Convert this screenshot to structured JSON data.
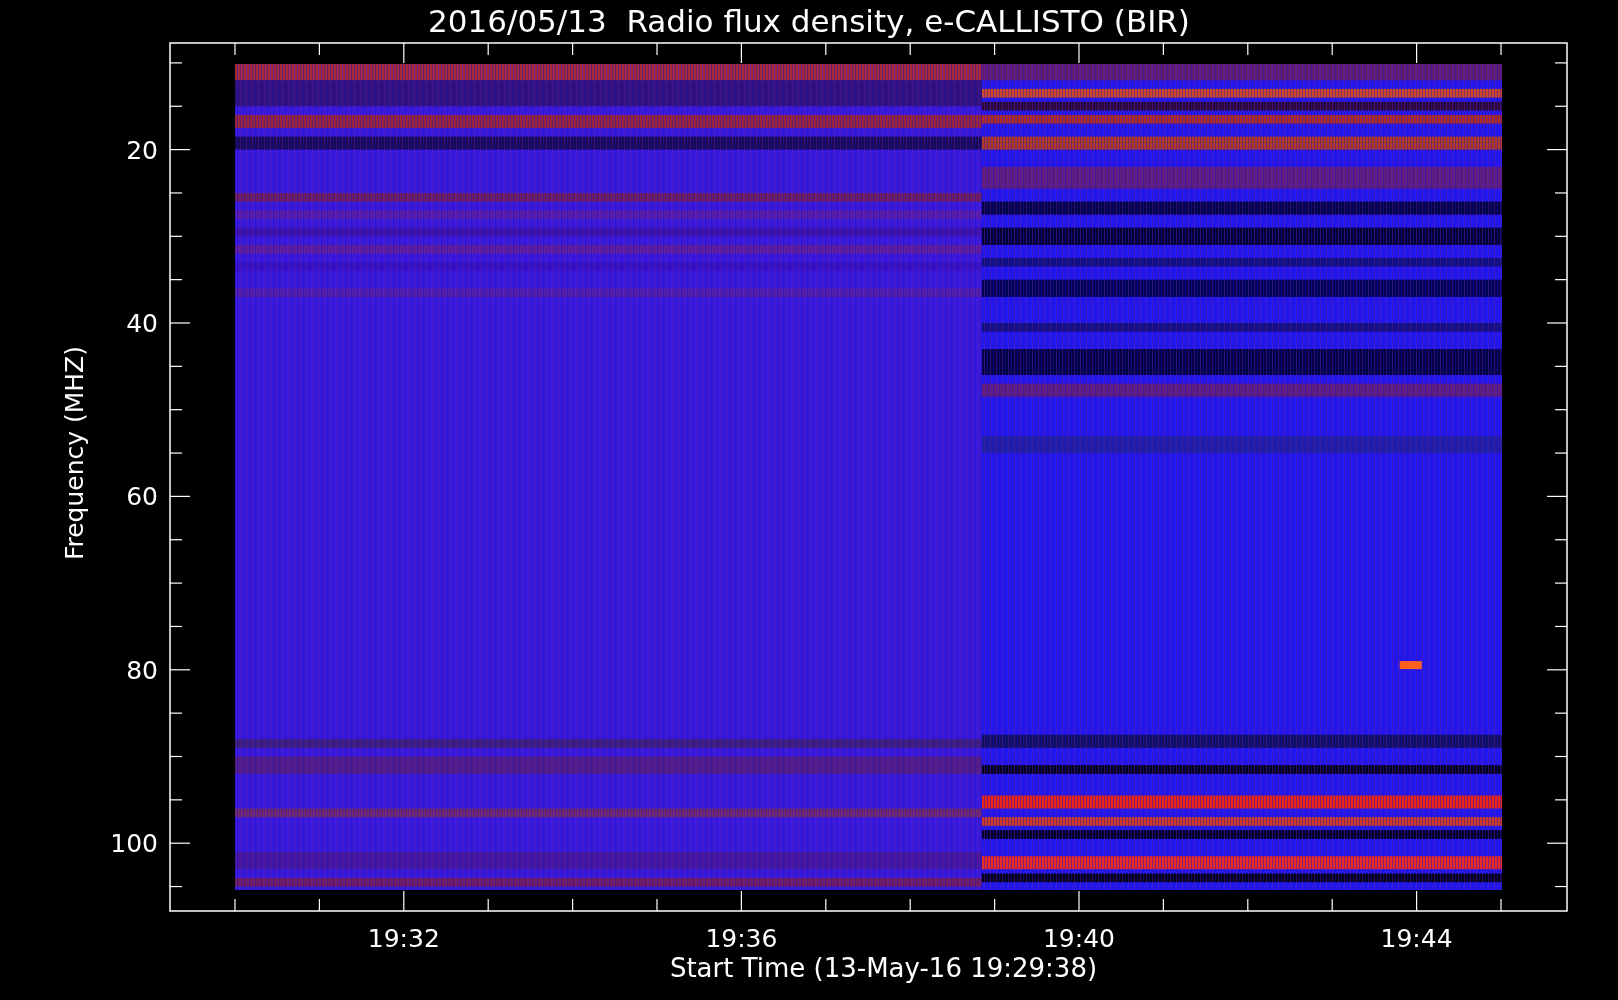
{
  "title": "2016/05/13  Radio flux density, e-CALLISTO (BIR)",
  "plot": {
    "ylabel": "Frequency (MHZ)",
    "xlabel": "Start Time (13-May-16 19:29:38)",
    "yticks": [
      "20",
      "40",
      "60",
      "80",
      "100"
    ],
    "xticks": [
      "19:32",
      "19:36",
      "19:40",
      "19:44"
    ]
  }
}
